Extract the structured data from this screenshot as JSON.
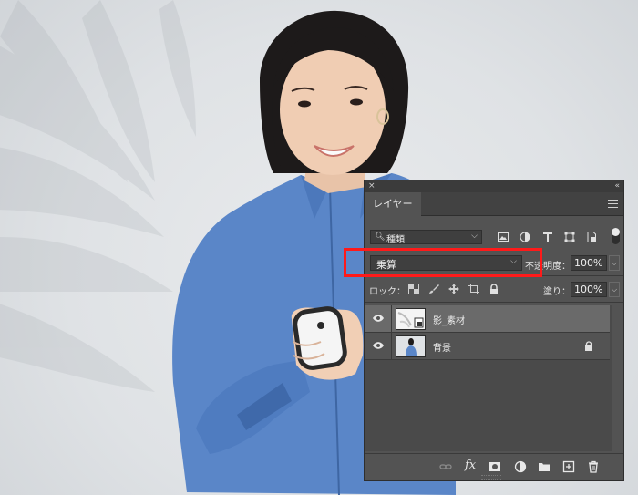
{
  "panel": {
    "close_glyph": "×",
    "collapse_glyph": "«",
    "tab_label": "レイヤー",
    "menu_icon": "panel-menu-icon",
    "filter": {
      "icon": "search-icon",
      "value": "種類",
      "chevron": "⌵"
    },
    "filter_icons": [
      "pixel-filter-icon",
      "adjustment-filter-icon",
      "type-filter-icon",
      "shape-filter-icon",
      "smart-object-filter-icon"
    ],
    "blend_mode": {
      "value": "乗算",
      "chevron": "⌵"
    },
    "opacity": {
      "label": "不透明度：",
      "value": "100%"
    },
    "lock": {
      "label": "ロック：",
      "icons": [
        "lock-transparent-icon",
        "lock-image-icon",
        "lock-position-icon",
        "lock-artboard-icon",
        "lock-all-icon"
      ]
    },
    "fill": {
      "label": "塗り：",
      "value": "100%"
    },
    "layers": [
      {
        "name": "影_素材",
        "visible": true,
        "selected": true,
        "locked": false,
        "thumb": "smart-object-thumbnail"
      },
      {
        "name": "背景",
        "visible": true,
        "selected": false,
        "locked": true,
        "thumb": "photo-thumbnail"
      }
    ],
    "bottom_icons": [
      "link-layers-icon",
      "layer-style-icon",
      "add-mask-icon",
      "new-adjustment-layer-icon",
      "new-group-icon",
      "new-layer-icon",
      "delete-layer-icon"
    ],
    "fx_label": "fx"
  },
  "colors": {
    "panel_bg": "#535353",
    "titlebar_bg": "#3b3b3b",
    "highlight": "#ff1a1a",
    "shirt": "#5a86c8"
  }
}
